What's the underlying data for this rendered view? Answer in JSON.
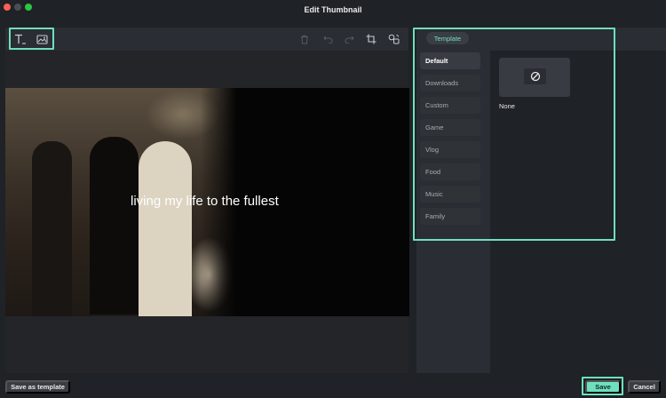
{
  "window": {
    "title": "Edit Thumbnail"
  },
  "toolbar": {
    "left_tools": [
      {
        "name": "text-tool-icon"
      },
      {
        "name": "image-tool-icon"
      }
    ],
    "right_tools": [
      {
        "name": "delete-icon",
        "enabled": false
      },
      {
        "name": "undo-icon",
        "enabled": false
      },
      {
        "name": "redo-icon",
        "enabled": false
      },
      {
        "name": "crop-icon",
        "enabled": true
      },
      {
        "name": "replace-frame-icon",
        "enabled": true
      }
    ]
  },
  "preview": {
    "caption": "living my life to the fullest"
  },
  "panel": {
    "tab": "Template",
    "categories": [
      "Default",
      "Downloads",
      "Custom",
      "Game",
      "Vlog",
      "Food",
      "Music",
      "Family"
    ],
    "active_category": "Default",
    "templates": [
      {
        "label": "None",
        "icon": "none-icon"
      }
    ]
  },
  "footer": {
    "save_as_template": "Save as template",
    "save": "Save",
    "cancel": "Cancel"
  },
  "colors": {
    "accent": "#6ee0bd",
    "background": "#1f2226",
    "panel": "#2a2d33"
  }
}
